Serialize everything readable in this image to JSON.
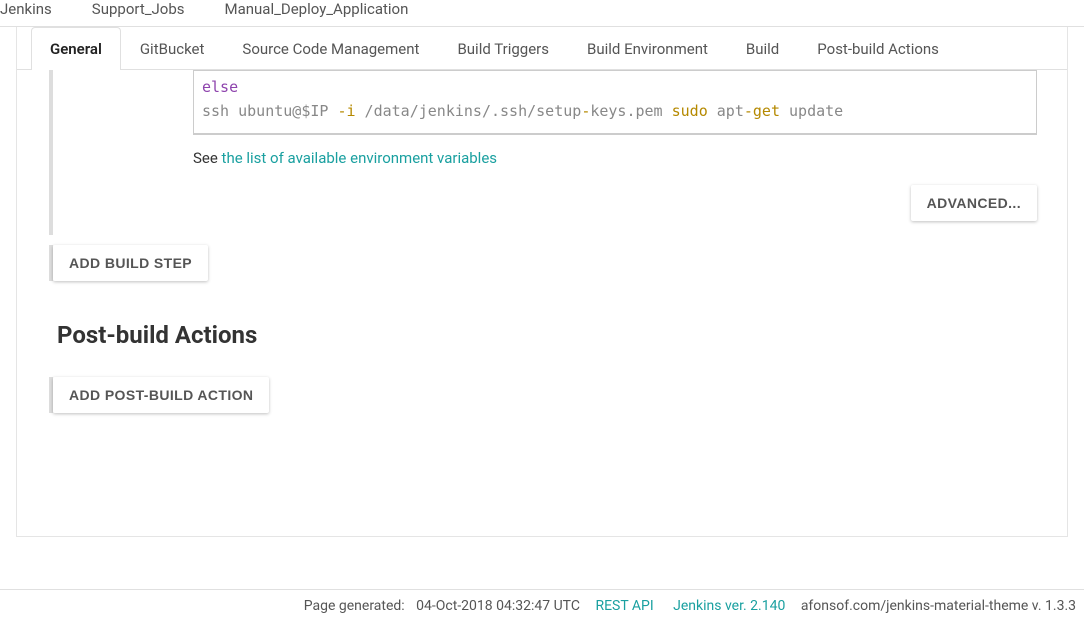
{
  "breadcrumb": {
    "items": [
      "Jenkins",
      "Support_Jobs",
      "Manual_Deploy_Application"
    ]
  },
  "tabs": {
    "items": [
      {
        "label": "General",
        "active": true
      },
      {
        "label": "GitBucket",
        "active": false
      },
      {
        "label": "Source Code Management",
        "active": false
      },
      {
        "label": "Build Triggers",
        "active": false
      },
      {
        "label": "Build Environment",
        "active": false
      },
      {
        "label": "Build",
        "active": false
      },
      {
        "label": "Post-build Actions",
        "active": false
      }
    ]
  },
  "code": {
    "line1": "else",
    "line2_ssh": "ssh",
    "line2_host": " ubuntu@$IP ",
    "line2_i": "-i",
    "line2_path": " /data/jenkins/.ssh/setup",
    "line2_dash1": "-",
    "line2_keys": "keys",
    "line2_dot": ".",
    "line2_pem": "pem ",
    "line2_sudo": "sudo",
    "line2_apt": " apt",
    "line2_dash2": "-",
    "line2_get": "get",
    "line2_update": " update"
  },
  "help": {
    "prefix": "See ",
    "link": "the list of available environment variables"
  },
  "buttons": {
    "advanced": "Advanced...",
    "add_build_step": "Add build step",
    "add_post_build": "Add post-build action"
  },
  "sections": {
    "post_build_title": "Post-build Actions"
  },
  "footer": {
    "generated_prefix": "Page generated: ",
    "generated_time": "04-Oct-2018 04:32:47 UTC",
    "rest_api": "REST API",
    "version": "Jenkins ver. 2.140",
    "theme": "afonsof.com/jenkins-material-theme v. 1.3.3"
  }
}
